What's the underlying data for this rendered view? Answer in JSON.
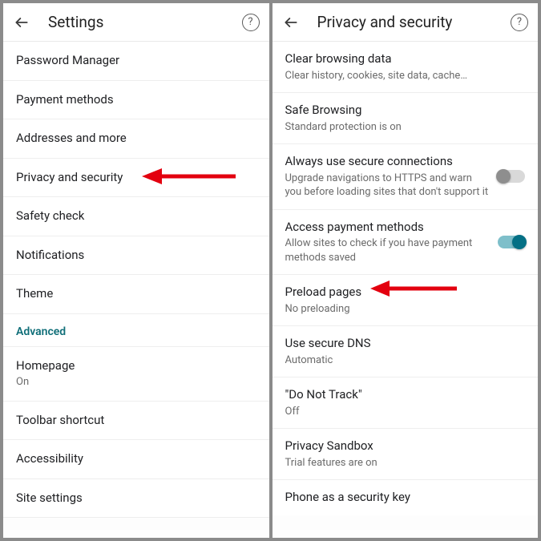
{
  "left": {
    "title": "Settings",
    "items": [
      {
        "label": "Password Manager"
      },
      {
        "label": "Payment methods"
      },
      {
        "label": "Addresses and more"
      },
      {
        "label": "Privacy and security"
      },
      {
        "label": "Safety check"
      },
      {
        "label": "Notifications"
      },
      {
        "label": "Theme"
      }
    ],
    "sectionLabel": "Advanced",
    "advanced": [
      {
        "label": "Homepage",
        "sub": "On"
      },
      {
        "label": "Toolbar shortcut"
      },
      {
        "label": "Accessibility"
      },
      {
        "label": "Site settings"
      }
    ]
  },
  "right": {
    "title": "Privacy and security",
    "items": [
      {
        "label": "Clear browsing data",
        "sub": "Clear history, cookies, site data, cache…"
      },
      {
        "label": "Safe Browsing",
        "sub": "Standard protection is on"
      },
      {
        "label": "Always use secure connections",
        "sub": "Upgrade navigations to HTTPS and warn you before loading sites that don't support it",
        "toggle": "off"
      },
      {
        "label": "Access payment methods",
        "sub": "Allow sites to check if you have payment methods saved",
        "toggle": "on"
      },
      {
        "label": "Preload pages",
        "sub": "No preloading"
      },
      {
        "label": "Use secure DNS",
        "sub": "Automatic"
      },
      {
        "label": "\"Do Not Track\"",
        "sub": "Off"
      },
      {
        "label": "Privacy Sandbox",
        "sub": "Trial features are on"
      },
      {
        "label": "Phone as a security key"
      }
    ]
  }
}
